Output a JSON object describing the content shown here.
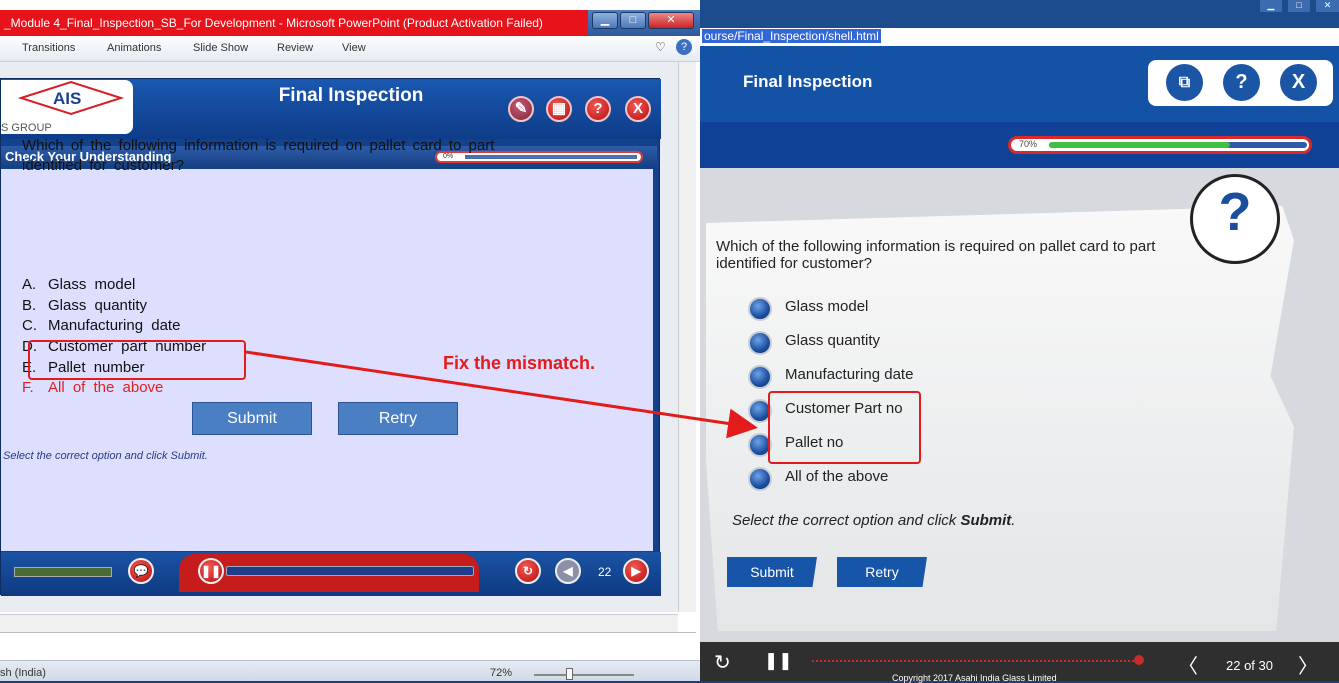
{
  "ppt": {
    "window_title": "_Module 4_Final_Inspection_SB_For Development  -  Microsoft PowerPoint (Product Activation Failed)",
    "ribbon_tabs": [
      "Transitions",
      "Animations",
      "Slide Show",
      "Review",
      "View"
    ],
    "slide": {
      "logo": "AIS",
      "logo_sub": "S GROUP",
      "title": "Final Inspection",
      "section": "Check Your Understanding",
      "progress": "0%",
      "question": "Which of the following  information  is required on pallet  card to part identified  for customer?",
      "options": [
        {
          "letter": "A.",
          "text": "Glass  model"
        },
        {
          "letter": "B.",
          "text": "Glass  quantity"
        },
        {
          "letter": "C.",
          "text": "Manufacturing  date"
        },
        {
          "letter": "D.",
          "text": "Customer  part number"
        },
        {
          "letter": "E.",
          "text": "Pallet  number"
        },
        {
          "letter": "F.",
          "text": "All of the  above"
        }
      ],
      "submit": "Submit",
      "retry": "Retry",
      "hint": "Select the correct option and click Submit.",
      "page": "22"
    },
    "status_lang": "sh (India)",
    "zoom": "72%"
  },
  "annotation": {
    "text": "Fix the mismatch."
  },
  "course": {
    "url": "ourse/Final_Inspection/shell.html",
    "title": "Final Inspection",
    "header_buttons": [
      "?",
      "X"
    ],
    "progress": "70%",
    "progress_value": 0.7,
    "question": "Which of the following information is required on pallet card to part identified for customer?",
    "options": [
      "Glass model",
      "Glass quantity",
      "Manufacturing date",
      "Customer Part no",
      "Pallet no",
      "All of the above"
    ],
    "hint_prefix": "Select the correct option and click ",
    "hint_bold": "Submit",
    "hint_suffix": ".",
    "submit": "Submit",
    "retry": "Retry",
    "page": "22 of 30",
    "copyright": "Copyright 2017 Asahi India Glass Limited"
  }
}
